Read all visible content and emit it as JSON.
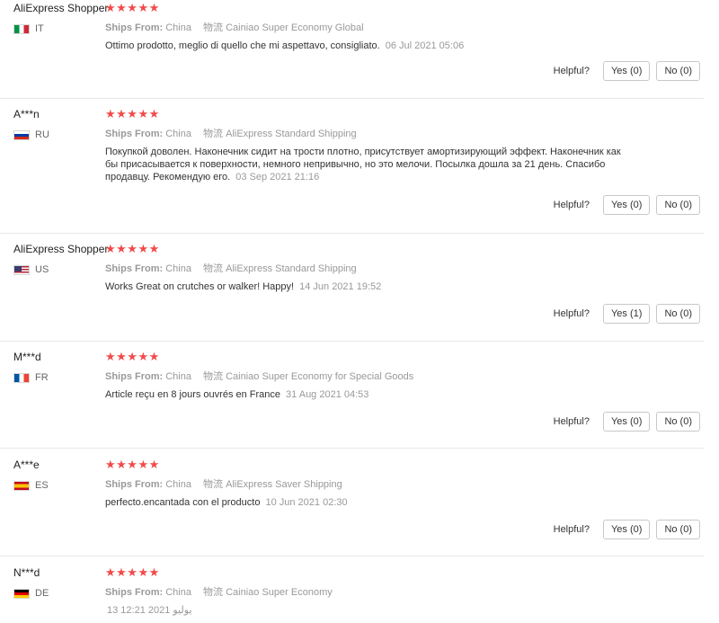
{
  "helpful_label": "Helpful?",
  "ships_from_label": "Ships From:",
  "shipping_label": "物流",
  "star_color": "#f24a4a",
  "reviews": [
    {
      "user": "AliExpress Shopper",
      "country": "IT",
      "rating": 5,
      "stars": "★★★★★",
      "ships_from": "China",
      "logistics": "Cainiao Super Economy Global",
      "text": "Ottimo prodotto, meglio di quello che mi aspettavo, consigliato.",
      "date": "06 Jul 2021 05:06",
      "yes": "Yes (0)",
      "no": "No (0)"
    },
    {
      "user": "A***n",
      "country": "RU",
      "rating": 5,
      "stars": "★★★★★",
      "ships_from": "China",
      "logistics": "AliExpress Standard Shipping",
      "text": "Покупкой доволен. Наконечник сидит на трости плотно, присутствует амортизирующий эффект. Наконечник как бы присасывается к поверхности, немного непривычно, но это мелочи. Посылка дошла за 21 день. Спасибо продавцу. Рекомендую его.",
      "date": "03 Sep 2021 21:16",
      "yes": "Yes (0)",
      "no": "No (0)"
    },
    {
      "user": "AliExpress Shopper",
      "country": "US",
      "rating": 5,
      "stars": "★★★★★",
      "ships_from": "China",
      "logistics": "AliExpress Standard Shipping",
      "text": "Works Great on crutches or walker! Happy!",
      "date": "14 Jun 2021 19:52",
      "yes": "Yes (1)",
      "no": "No (0)"
    },
    {
      "user": "M***d",
      "country": "FR",
      "rating": 5,
      "stars": "★★★★★",
      "ships_from": "China",
      "logistics": "Cainiao Super Economy for Special Goods",
      "text": "Article reçu en 8 jours ouvrés en France",
      "date": "31 Aug 2021 04:53",
      "yes": "Yes (0)",
      "no": "No (0)"
    },
    {
      "user": "A***e",
      "country": "ES",
      "rating": 5,
      "stars": "★★★★★",
      "ships_from": "China",
      "logistics": "AliExpress Saver Shipping",
      "text": "perfecto.encantada con el producto",
      "date": "10 Jun 2021 02:30",
      "yes": "Yes (0)",
      "no": "No (0)"
    },
    {
      "user": "N***d",
      "country": "DE",
      "rating": 5,
      "stars": "★★★★★",
      "ships_from": "China",
      "logistics": "Cainiao Super Economy",
      "text": "",
      "date": "13 يوليو 2021 12:21",
      "yes": "",
      "no": ""
    }
  ]
}
